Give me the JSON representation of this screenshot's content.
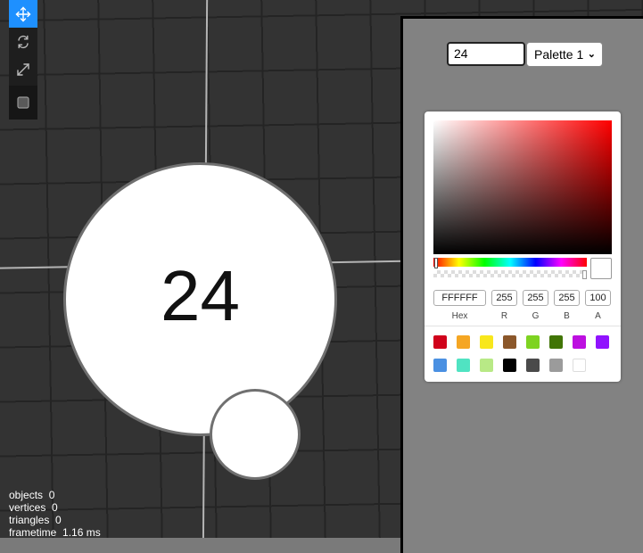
{
  "toolbar": {
    "tools": [
      {
        "icon": "move-icon",
        "active": true
      },
      {
        "icon": "rotate-icon",
        "active": false
      },
      {
        "icon": "scale-icon",
        "active": false
      },
      {
        "icon": "select-box-icon",
        "active": false
      }
    ]
  },
  "scene": {
    "main_bubble_text": "24"
  },
  "stats": {
    "objects_label": "objects",
    "objects_value": "0",
    "vertices_label": "vertices",
    "vertices_value": "0",
    "triangles_label": "triangles",
    "triangles_value": "0",
    "frametime_label": "frametime",
    "frametime_value": "1.16 ms"
  },
  "panel": {
    "text_input_value": "24",
    "palette_select": "Palette 1",
    "palette_options": [
      "Palette 1"
    ]
  },
  "color_picker": {
    "hue_color": "#ff0000",
    "current_color": "#FFFFFF",
    "hex": "FFFFFF",
    "r": "255",
    "g": "255",
    "b": "255",
    "a": "100",
    "labels": {
      "hex": "Hex",
      "r": "R",
      "g": "G",
      "b": "B",
      "a": "A"
    },
    "preset_swatches": [
      "#d0021b",
      "#f5a623",
      "#f8e71c",
      "#8b572a",
      "#7ed321",
      "#417505",
      "#bd10e0",
      "#9013fe",
      "#4a90e2",
      "#50e3c2",
      "#b8e986",
      "#000000",
      "#4a4a4a",
      "#9b9b9b",
      "#ffffff"
    ]
  }
}
